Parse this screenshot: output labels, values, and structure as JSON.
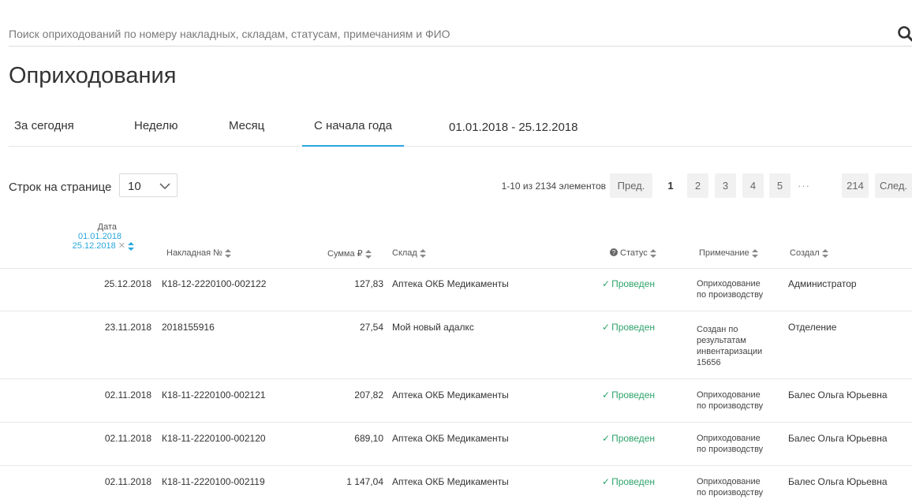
{
  "search": {
    "placeholder": "Поиск оприходований по номеру накладных, складам, статусам, примечаниям и ФИО"
  },
  "page_title": "Оприходования",
  "tabs": [
    {
      "label": "За сегодня"
    },
    {
      "label": "Неделю"
    },
    {
      "label": "Месяц"
    },
    {
      "label": "С начала года",
      "active": true
    }
  ],
  "date_range": "01.01.2018 - 25.12.2018",
  "rows_per_page": {
    "label": "Строк на странице",
    "value": "10"
  },
  "pagination": {
    "info": "1-10 из 2134 элементов",
    "prev": "Пред.",
    "pages": [
      "1",
      "2",
      "3",
      "4",
      "5"
    ],
    "dots": "···",
    "last": "214",
    "next": "След."
  },
  "table": {
    "headers": {
      "date": "Дата",
      "date_from": "01.01.2018",
      "date_to": "25.12.2018",
      "invoice": "Накладная №",
      "sum": "Сумма ₽",
      "warehouse": "Склад",
      "status": "Статус",
      "note": "Примечание",
      "created_by": "Создал"
    },
    "rows": [
      {
        "date": "25.12.2018",
        "invoice": "К18-12-2220100-002122",
        "sum": "127,83",
        "warehouse": "Аптека ОКБ Медикаменты",
        "status": "Проведен",
        "note": "Оприходование по производству",
        "created_by": "Администратор"
      },
      {
        "date": "23.11.2018",
        "invoice": "2018155916",
        "sum": "27,54",
        "warehouse": "Мой новый адалкс",
        "status": "Проведен",
        "note": "Создан по результатам инвентаризации 15656",
        "created_by": "Отделение"
      },
      {
        "date": "02.11.2018",
        "invoice": "К18-11-2220100-002121",
        "sum": "207,82",
        "warehouse": "Аптека ОКБ Медикаменты",
        "status": "Проведен",
        "note": "Оприходование по производству",
        "created_by": "Балес Ольга Юрьевна"
      },
      {
        "date": "02.11.2018",
        "invoice": "К18-11-2220100-002120",
        "sum": "689,10",
        "warehouse": "Аптека ОКБ Медикаменты",
        "status": "Проведен",
        "note": "Оприходование по производству",
        "created_by": "Балес Ольга Юрьевна"
      },
      {
        "date": "02.11.2018",
        "invoice": "К18-11-2220100-002119",
        "sum": "1 147,04",
        "warehouse": "Аптека ОКБ Медикаменты",
        "status": "Проведен",
        "note": "Оприходование по производству",
        "created_by": "Балес Ольга Юрьевна"
      }
    ]
  },
  "colors": {
    "accent": "#27a8de",
    "status_ok": "#2fa36b"
  }
}
